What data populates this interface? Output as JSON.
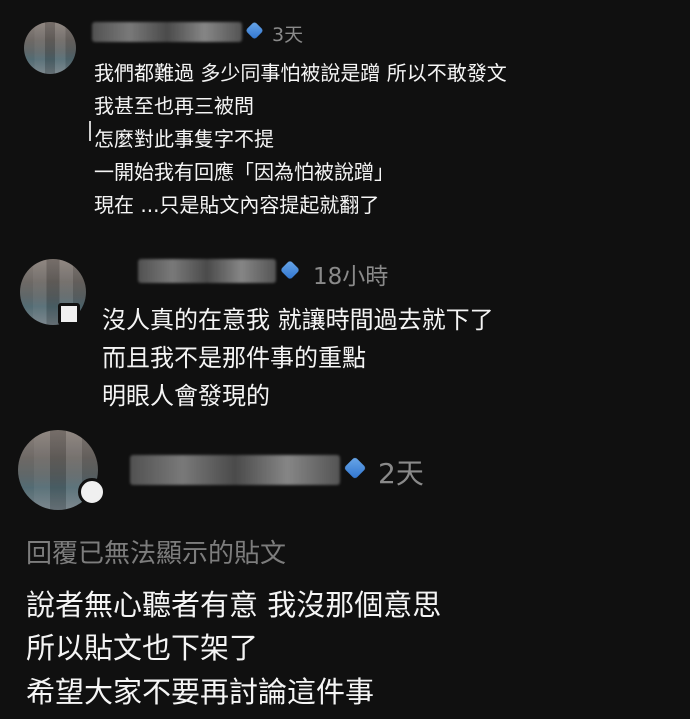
{
  "comments": [
    {
      "time": "3天",
      "lines": [
        "我們都難過 多少同事怕被說是蹭 所以不敢發文",
        "我甚至也再三被問",
        "怎麼對此事隻字不提",
        "一開始我有回應「因為怕被說蹭」",
        "現在 ...只是貼文內容提起就翻了"
      ]
    },
    {
      "time": "18小時",
      "lines": [
        "沒人真的在意我 就讓時間過去就下了",
        "而且我不是那件事的重點",
        "明眼人會發現的"
      ]
    },
    {
      "time": "2天",
      "removed_notice": "回覆已無法顯示的貼文",
      "lines": [
        "說者無心聽者有意 我沒那個意思",
        "所以貼文也下架了",
        "希望大家不要再討論這件事"
      ]
    }
  ],
  "colors": {
    "background": "#101010",
    "text": "#f5f5f5",
    "muted": "#8a8a8a",
    "verified": "#2f74cf"
  }
}
